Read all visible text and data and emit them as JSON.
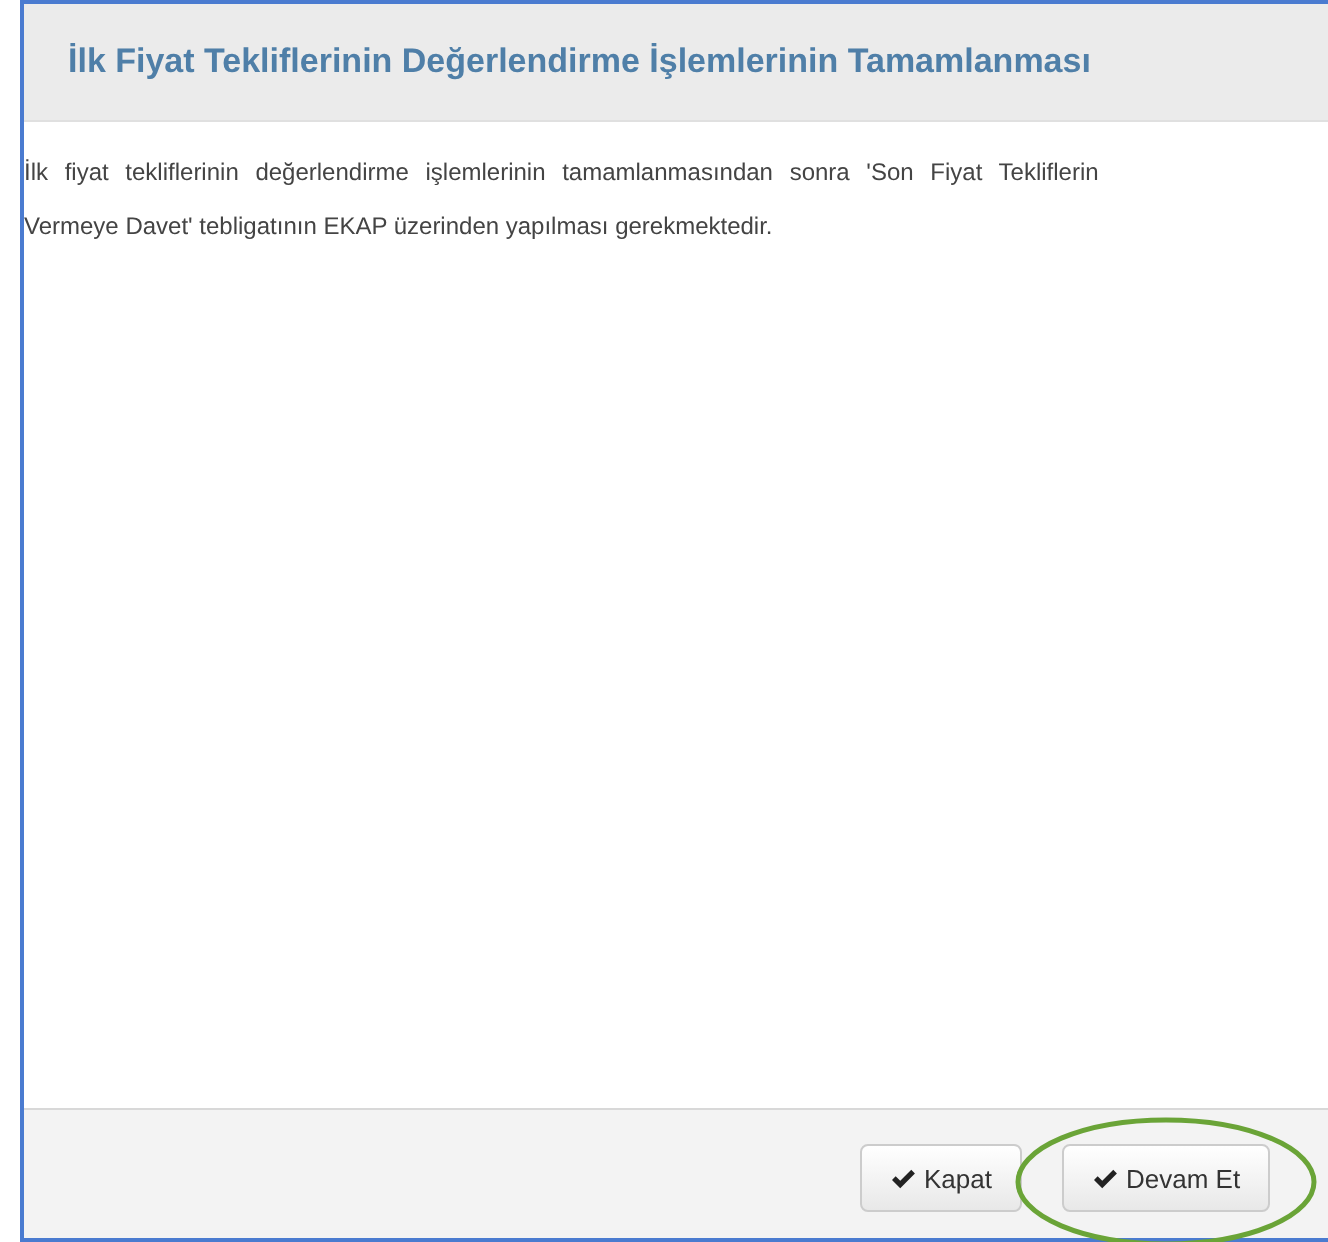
{
  "dialog": {
    "title": "İlk Fiyat Tekliflerinin Değerlendirme İşlemlerinin Tamamlanması",
    "message_lines": [
      "İlk fiyat tekliflerinin değerlendirme işlemlerinin tamamlanmasından sonra 'Son Fiyat Tekliflerin",
      "Vermeye Davet' tebligatının EKAP üzerinden yapılması gerekmektedir."
    ],
    "buttons": [
      {
        "label": "Kapat",
        "highlighted": false
      },
      {
        "label": "Devam Et",
        "highlighted": true
      }
    ]
  }
}
